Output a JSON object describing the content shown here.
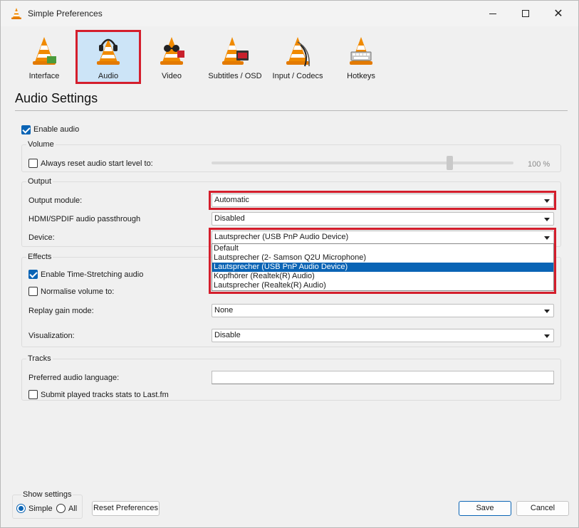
{
  "window": {
    "title": "Simple Preferences"
  },
  "icons": {
    "app": "vlc-cone-icon",
    "minimize": "minimize-icon",
    "maximize": "maximize-icon",
    "close": "close-icon",
    "interface": "cone-interface-icon",
    "audio": "cone-headphones-icon",
    "video": "cone-glasses-icon",
    "subtitles": "cone-clapperboard-icon",
    "input": "cone-cable-icon",
    "hotkeys": "cone-keyboard-icon"
  },
  "colors": {
    "accent": "#0a64b5",
    "highlight_box": "#d41e2c",
    "selected_tab": "#cce4f7",
    "cone_orange": "#f08a00"
  },
  "categories": [
    {
      "label": "Interface",
      "selected": false
    },
    {
      "label": "Audio",
      "selected": true
    },
    {
      "label": "Video",
      "selected": false
    },
    {
      "label": "Subtitles / OSD",
      "selected": false
    },
    {
      "label": "Input / Codecs",
      "selected": false
    },
    {
      "label": "Hotkeys",
      "selected": false
    }
  ],
  "section_title": "Audio Settings",
  "enable_audio": {
    "label": "Enable audio",
    "checked": true
  },
  "volume": {
    "group_label": "Volume",
    "reset_label": "Always reset audio start level to:",
    "reset_checked": false,
    "level_text": "100 %",
    "level_fraction": 0.79
  },
  "output": {
    "group_label": "Output",
    "module_label": "Output module:",
    "module_value": "Automatic",
    "passthrough_label": "HDMI/SPDIF audio passthrough",
    "passthrough_value": "Disabled",
    "device_label": "Device:",
    "device_value": "Lautsprecher (USB PnP Audio Device)",
    "device_options": [
      "Default",
      "Lautsprecher (2- Samson Q2U Microphone)",
      "Lautsprecher (USB PnP Audio Device)",
      "Kopfhörer (Realtek(R) Audio)",
      "Lautsprecher (Realtek(R) Audio)"
    ],
    "device_selected_index": 2
  },
  "effects": {
    "group_label": "Effects",
    "time_stretch_label": "Enable Time-Stretching audio",
    "time_stretch_checked": true,
    "normalise_label": "Normalise volume to:",
    "normalise_checked": false,
    "replay_gain_label": "Replay gain mode:",
    "replay_gain_value": "None",
    "visualization_label": "Visualization:",
    "visualization_value": "Disable"
  },
  "tracks": {
    "group_label": "Tracks",
    "language_label": "Preferred audio language:",
    "language_value": "",
    "lastfm_label": "Submit played tracks stats to Last.fm",
    "lastfm_checked": false
  },
  "show_settings": {
    "label": "Show settings",
    "simple_label": "Simple",
    "all_label": "All",
    "selected": "Simple"
  },
  "buttons": {
    "reset": "Reset Preferences",
    "save": "Save",
    "cancel": "Cancel"
  }
}
